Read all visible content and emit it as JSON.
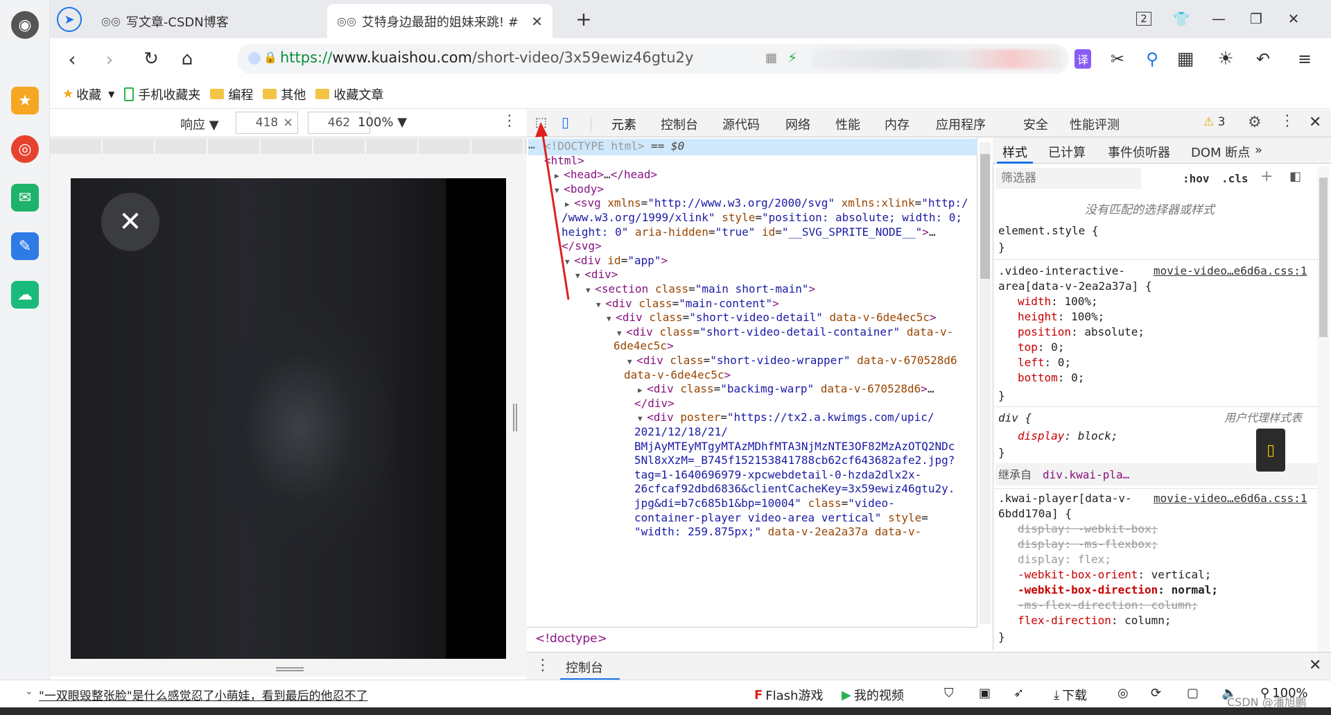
{
  "tabs": [
    {
      "label": "写文章-CSDN博客",
      "active": false
    },
    {
      "label": "艾特身边最甜的姐妹来跳! #",
      "active": true
    }
  ],
  "window": {
    "tab_count": "2",
    "new_tab": "+"
  },
  "nav": {
    "url_scheme": "https://",
    "url_host": "www.kuaishou.com",
    "url_path": "/short-video/3x59ewiz46gtu2y"
  },
  "bookmarks": [
    "收藏",
    "手机收藏夹",
    "编程",
    "其他",
    "收藏文章"
  ],
  "device_toolbar": {
    "mode": "响应",
    "width": "418",
    "times": "×",
    "height": "462",
    "zoom": "100%"
  },
  "devtools": {
    "tabs": [
      "元素",
      "控制台",
      "源代码",
      "网络",
      "性能",
      "内存",
      "应用程序",
      "安全",
      "性能评测"
    ],
    "active_tab": "元素",
    "warning_count": "3",
    "breadcrumb": "<!doctype>",
    "drawer_tab": "控制台"
  },
  "dom_lines": [
    {
      "indent": 0,
      "parts": [
        [
          "tg",
          "<!DOCTYPE html>"
        ],
        [
          "tx",
          " == $0"
        ]
      ],
      "selected": true
    },
    {
      "indent": 0,
      "parts": [
        [
          "tg",
          "<html>"
        ]
      ]
    },
    {
      "indent": 1,
      "arrow": "▶",
      "parts": [
        [
          "tg",
          "<head>"
        ],
        [
          "tx",
          "…"
        ],
        [
          "tg",
          "</head>"
        ]
      ]
    },
    {
      "indent": 1,
      "arrow": "▼",
      "parts": [
        [
          "tg",
          "<body>"
        ]
      ]
    },
    {
      "indent": 2,
      "arrow": "▶",
      "parts": [
        [
          "tg",
          "<svg "
        ],
        [
          "an",
          "xmlns"
        ],
        [
          "tx",
          "="
        ],
        [
          "av",
          "\"http://www.w3.org/2000/svg\""
        ],
        [
          "tx",
          " "
        ],
        [
          "an",
          "xmlns:xlink"
        ],
        [
          "tx",
          "="
        ],
        [
          "av",
          "\"http:/"
        ]
      ]
    },
    {
      "indent": 1,
      "cont": true,
      "parts": [
        [
          "av",
          "/www.w3.org/1999/xlink\""
        ],
        [
          "tx",
          " "
        ],
        [
          "an",
          "style"
        ],
        [
          "tx",
          "="
        ],
        [
          "av",
          "\"position: absolute; width: 0;"
        ]
      ]
    },
    {
      "indent": 1,
      "cont": true,
      "parts": [
        [
          "av",
          "height: 0\""
        ],
        [
          "tx",
          " "
        ],
        [
          "an",
          "aria-hidden"
        ],
        [
          "tx",
          "="
        ],
        [
          "av",
          "\"true\""
        ],
        [
          "tx",
          " "
        ],
        [
          "an",
          "id"
        ],
        [
          "tx",
          "="
        ],
        [
          "av",
          "\"__SVG_SPRITE_NODE__\""
        ],
        [
          "tg",
          ">"
        ],
        [
          "tx",
          "…"
        ]
      ]
    },
    {
      "indent": 1,
      "cont": true,
      "parts": [
        [
          "tg",
          "</svg>"
        ]
      ]
    },
    {
      "indent": 2,
      "arrow": "▼",
      "parts": [
        [
          "tg",
          "<div "
        ],
        [
          "an",
          "id"
        ],
        [
          "tx",
          "="
        ],
        [
          "av",
          "\"app\""
        ],
        [
          "tg",
          ">"
        ]
      ]
    },
    {
      "indent": 3,
      "arrow": "▼",
      "parts": [
        [
          "tg",
          "<div>"
        ]
      ]
    },
    {
      "indent": 4,
      "arrow": "▼",
      "parts": [
        [
          "tg",
          "<section "
        ],
        [
          "an",
          "class"
        ],
        [
          "tx",
          "="
        ],
        [
          "av",
          "\"main short-main\""
        ],
        [
          "tg",
          ">"
        ]
      ]
    },
    {
      "indent": 5,
      "arrow": "▼",
      "parts": [
        [
          "tg",
          "<div "
        ],
        [
          "an",
          "class"
        ],
        [
          "tx",
          "="
        ],
        [
          "av",
          "\"main-content\""
        ],
        [
          "tg",
          ">"
        ]
      ]
    },
    {
      "indent": 6,
      "arrow": "▼",
      "parts": [
        [
          "tg",
          "<div "
        ],
        [
          "an",
          "class"
        ],
        [
          "tx",
          "="
        ],
        [
          "av",
          "\"short-video-detail\""
        ],
        [
          "tx",
          " "
        ],
        [
          "an",
          "data-v-6de4ec5c"
        ],
        [
          "tg",
          ">"
        ]
      ]
    },
    {
      "indent": 7,
      "arrow": "▼",
      "parts": [
        [
          "tg",
          "<div "
        ],
        [
          "an",
          "class"
        ],
        [
          "tx",
          "="
        ],
        [
          "av",
          "\"short-video-detail-container\""
        ],
        [
          "tx",
          " "
        ],
        [
          "an",
          "data-v-"
        ]
      ]
    },
    {
      "indent": 6,
      "cont": true,
      "parts": [
        [
          "an",
          "6de4ec5c"
        ],
        [
          "tg",
          ">"
        ]
      ]
    },
    {
      "indent": 8,
      "arrow": "▼",
      "parts": [
        [
          "tg",
          "<div "
        ],
        [
          "an",
          "class"
        ],
        [
          "tx",
          "="
        ],
        [
          "av",
          "\"short-video-wrapper\""
        ],
        [
          "tx",
          " "
        ],
        [
          "an",
          "data-v-670528d6"
        ]
      ]
    },
    {
      "indent": 7,
      "cont": true,
      "parts": [
        [
          "an",
          "data-v-6de4ec5c"
        ],
        [
          "tg",
          ">"
        ]
      ]
    },
    {
      "indent": 9,
      "arrow": "▶",
      "parts": [
        [
          "tg",
          "<div "
        ],
        [
          "an",
          "class"
        ],
        [
          "tx",
          "="
        ],
        [
          "av",
          "\"backimg-warp\""
        ],
        [
          "tx",
          " "
        ],
        [
          "an",
          "data-v-670528d6"
        ],
        [
          "tg",
          ">"
        ],
        [
          "tx",
          "…"
        ]
      ]
    },
    {
      "indent": 8,
      "cont": true,
      "parts": [
        [
          "tg",
          "</div>"
        ]
      ]
    },
    {
      "indent": 9,
      "arrow": "▼",
      "parts": [
        [
          "tg",
          "<div "
        ],
        [
          "an",
          "poster"
        ],
        [
          "tx",
          "="
        ],
        [
          "av",
          "\"https://tx2.a.kwimgs.com/upic/"
        ]
      ]
    },
    {
      "indent": 8,
      "cont": true,
      "parts": [
        [
          "av",
          "2021/12/18/21/"
        ]
      ]
    },
    {
      "indent": 8,
      "cont": true,
      "parts": [
        [
          "av",
          "BMjAyMTEyMTgyMTAzMDhfMTA3NjMzNTE3OF82MzAzOTQ2NDc"
        ]
      ]
    },
    {
      "indent": 8,
      "cont": true,
      "parts": [
        [
          "av",
          "5Nl8xXzM=_B745f152153841788cb62cf643682afe2.jpg?"
        ]
      ]
    },
    {
      "indent": 8,
      "cont": true,
      "parts": [
        [
          "av",
          "tag=1-1640696979-xpcwebdetail-0-hzda2dlx2x-"
        ]
      ]
    },
    {
      "indent": 8,
      "cont": true,
      "parts": [
        [
          "av",
          "26cfcaf92dbd6836&clientCacheKey=3x59ewiz46gtu2y."
        ]
      ]
    },
    {
      "indent": 8,
      "cont": true,
      "parts": [
        [
          "av",
          "jpg&di=b7c685b1&bp=10004\""
        ],
        [
          "tx",
          " "
        ],
        [
          "an",
          "class"
        ],
        [
          "tx",
          "="
        ],
        [
          "av",
          "\"video-"
        ]
      ]
    },
    {
      "indent": 8,
      "cont": true,
      "parts": [
        [
          "av",
          "container-player video-area vertical\""
        ],
        [
          "tx",
          " "
        ],
        [
          "an",
          "style"
        ],
        [
          "tx",
          "="
        ]
      ]
    },
    {
      "indent": 8,
      "cont": true,
      "parts": [
        [
          "av",
          "\"width: 259.875px;\""
        ],
        [
          "tx",
          " "
        ],
        [
          "an",
          "data-v-2ea2a37a"
        ],
        [
          "tx",
          " "
        ],
        [
          "an",
          "data-v-"
        ]
      ]
    }
  ],
  "styles": {
    "tabs": [
      "样式",
      "已计算",
      "事件侦听器",
      "DOM 断点",
      "»"
    ],
    "filter_placeholder": "筛选器",
    "hov": ":hov",
    "cls": ".cls",
    "no_match": "没有匹配的选择器或样式",
    "element_style": "element.style {",
    "close_brace": "}",
    "rule1_selector_a": ".video-interactive-",
    "rule1_selector_b": "area[data-v-2ea2a37a] {",
    "rule1_source": "movie-video…e6d6a.css:1",
    "rule1_props": [
      [
        "width",
        "100%"
      ],
      [
        "height",
        "100%"
      ],
      [
        "position",
        "absolute"
      ],
      [
        "top",
        "0"
      ],
      [
        "left",
        "0"
      ],
      [
        "bottom",
        "0"
      ]
    ],
    "rule2_selector": "div {",
    "rule2_source": "用户代理样式表",
    "rule2_prop": [
      "display",
      "block"
    ],
    "inherited_label": "继承自",
    "inherited_from": "div.kwai-pla…",
    "rule3_selector_a": ".kwai-player[data-v-",
    "rule3_selector_b": "6bdd170a] {",
    "rule3_source": "movie-video…e6d6a.css:1",
    "rule3_props": [
      {
        "name": "display",
        "value": "-webkit-box",
        "struck": true
      },
      {
        "name": "display",
        "value": "-ms-flexbox",
        "struck": true
      },
      {
        "name": "display",
        "value": "flex",
        "struck": false,
        "plain": true
      },
      {
        "name": "-webkit-box-orient",
        "value": "vertical",
        "struck": false
      },
      {
        "name": "-webkit-box-direction",
        "value": "normal",
        "struck": false,
        "bold": true
      },
      {
        "name": "-ms-flex-direction",
        "value": "column",
        "struck": true
      },
      {
        "name": "flex-direction",
        "value": "column",
        "struck": false
      }
    ]
  },
  "statusbar": {
    "news": "\"一双眼毁整张脸\"是什么感觉忍了小萌娃，看到最后的他忍不了",
    "flash": "Flash游戏",
    "myvideo": "我的视频",
    "download": "下载",
    "zoom": "100%",
    "watermark": "CSDN @潘旭鹏"
  },
  "colors": {
    "accent": "#1a73e8",
    "url_green": "#0a8f3c",
    "tag": "#881280",
    "attr_name": "#994500",
    "attr_value": "#1a1aa6"
  }
}
